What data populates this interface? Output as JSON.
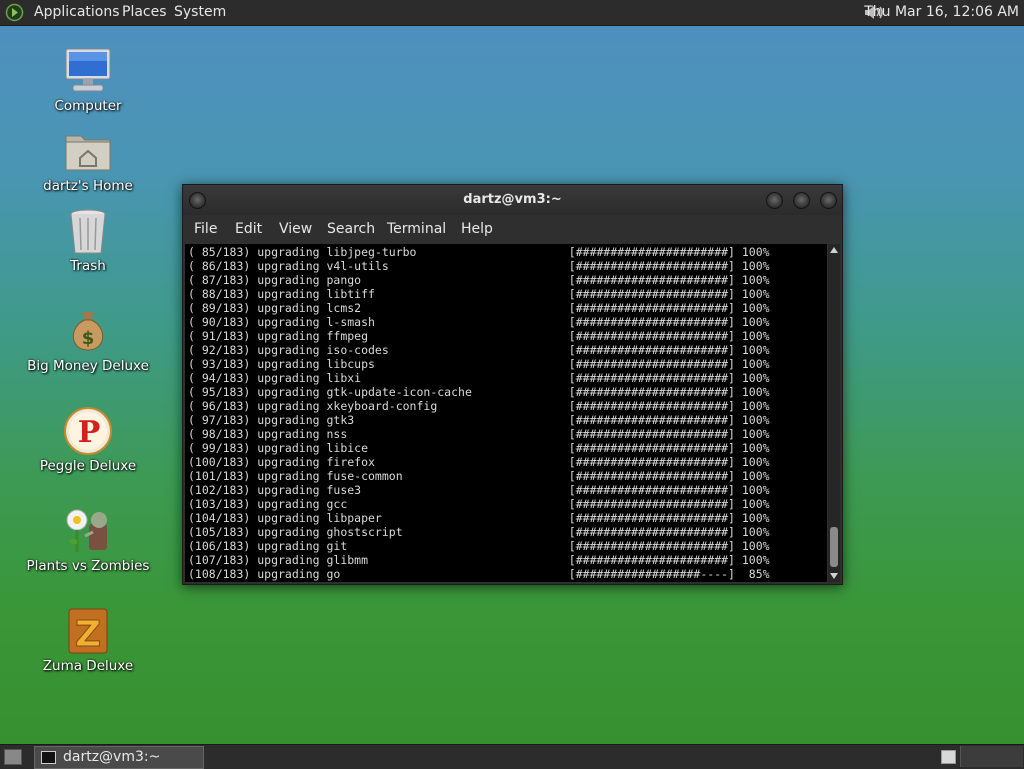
{
  "top_panel": {
    "menus": [
      "Applications",
      "Places",
      "System"
    ],
    "clock": "Thu Mar 16, 12:06 AM"
  },
  "desktop_icons": [
    {
      "label": "Computer",
      "icon": "computer-icon"
    },
    {
      "label": "dartz's Home",
      "icon": "home-folder-icon"
    },
    {
      "label": "Trash",
      "icon": "trash-icon"
    },
    {
      "label": "Big Money Deluxe",
      "icon": "money-bag-icon"
    },
    {
      "label": "Peggle Deluxe",
      "icon": "peggle-icon"
    },
    {
      "label": "Plants vs Zombies",
      "icon": "plants-vs-zombies-icon"
    },
    {
      "label": "Zuma Deluxe",
      "icon": "zuma-icon"
    }
  ],
  "terminal": {
    "title": "dartz@vm3:~",
    "menu": [
      "File",
      "Edit",
      "View",
      "Search",
      "Terminal",
      "Help"
    ],
    "lines": [
      "( 85/183) upgrading libjpeg-turbo                      [######################] 100%",
      "( 86/183) upgrading v4l-utils                          [######################] 100%",
      "( 87/183) upgrading pango                              [######################] 100%",
      "( 88/183) upgrading libtiff                            [######################] 100%",
      "( 89/183) upgrading lcms2                              [######################] 100%",
      "( 90/183) upgrading l-smash                            [######################] 100%",
      "( 91/183) upgrading ffmpeg                             [######################] 100%",
      "( 92/183) upgrading iso-codes                          [######################] 100%",
      "( 93/183) upgrading libcups                            [######################] 100%",
      "( 94/183) upgrading libxi                              [######################] 100%",
      "( 95/183) upgrading gtk-update-icon-cache              [######################] 100%",
      "( 96/183) upgrading xkeyboard-config                   [######################] 100%",
      "( 97/183) upgrading gtk3                               [######################] 100%",
      "( 98/183) upgrading nss                                [######################] 100%",
      "( 99/183) upgrading libice                             [######################] 100%",
      "(100/183) upgrading firefox                            [######################] 100%",
      "(101/183) upgrading fuse-common                        [######################] 100%",
      "(102/183) upgrading fuse3                              [######################] 100%",
      "(103/183) upgrading gcc                                [######################] 100%",
      "(104/183) upgrading libpaper                           [######################] 100%",
      "(105/183) upgrading ghostscript                        [######################] 100%",
      "(106/183) upgrading git                                [######################] 100%",
      "(107/183) upgrading glibmm                             [######################] 100%",
      "(108/183) upgrading go                                 [##################----]  85%"
    ]
  },
  "taskbar": {
    "tasks": [
      {
        "label": "dartz@vm3:~"
      }
    ]
  }
}
